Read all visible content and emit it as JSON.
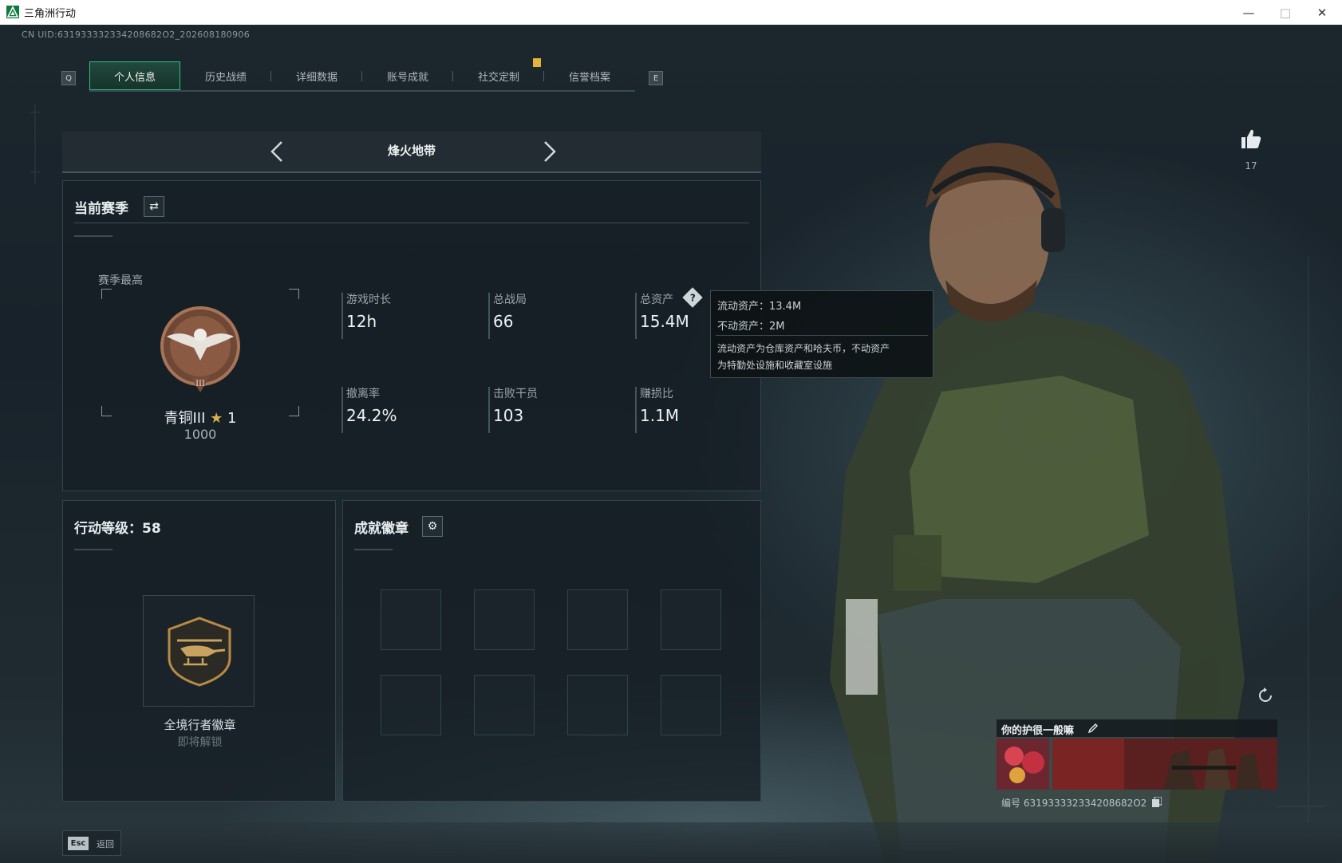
{
  "window": {
    "title": "三角洲行动"
  },
  "header": {
    "uid": "CN UID:631933332334208682O2_202608180906"
  },
  "tabs": [
    {
      "label": "个人信息",
      "active": true
    },
    {
      "label": "历史战绩"
    },
    {
      "label": "详细数据"
    },
    {
      "label": "账号成就"
    },
    {
      "label": "社交定制"
    },
    {
      "label": "信誉档案"
    }
  ],
  "keyhints": {
    "prev": "Q",
    "next": "E"
  },
  "mode": {
    "label": "烽火地带"
  },
  "season": {
    "title": "当前赛季",
    "best_label": "赛季最高",
    "rank_name": "青铜III",
    "rank_stars": "1",
    "rank_points": "1000",
    "stats": [
      {
        "label": "游戏时长",
        "value": "12h"
      },
      {
        "label": "总战局",
        "value": "66"
      },
      {
        "label": "总资产",
        "value": "15.4M"
      },
      {
        "label": "撤离率",
        "value": "24.2%"
      },
      {
        "label": "击败干员",
        "value": "103"
      },
      {
        "label": "赚损比",
        "value": "1.1M"
      }
    ]
  },
  "tooltip": {
    "liquid": "流动资产：13.4M",
    "fixed": "不动资产：2M",
    "desc1": "流动资产为仓库资产和哈夫币，不动资产",
    "desc2": "为特勤处设施和收藏室设施"
  },
  "level": {
    "title": "行动等级：58",
    "badge_name": "全境行者徽章",
    "badge_status": "即将解锁"
  },
  "badges": {
    "title": "成就徽章"
  },
  "likes": {
    "count": "17"
  },
  "card": {
    "slogan": "你的护很一般嘛",
    "id_text": "编号 631933332334208682O2"
  },
  "footer": {
    "esc_key": "Esc",
    "back_label": "返回"
  },
  "colors": {
    "accent": "#2ec27a",
    "warning": "#e3b23c",
    "panel": "#161f25"
  }
}
